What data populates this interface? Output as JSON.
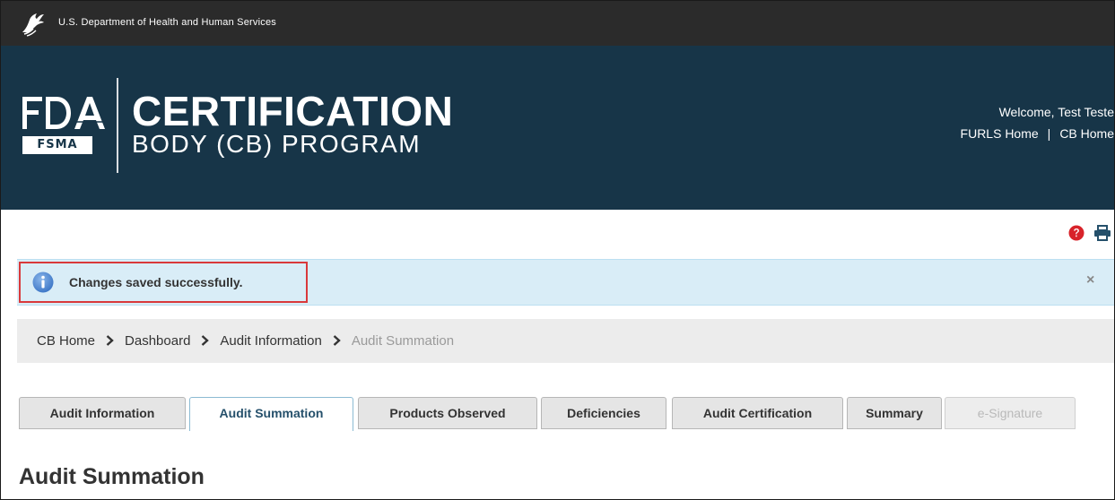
{
  "hhs_bar": {
    "text": "U.S. Department of Health and Human Services",
    "logo_icon": "hhs-eagle-icon"
  },
  "header": {
    "logo_icon": "fda-logo-icon",
    "fsma_badge": "FSMA",
    "title": "CERTIFICATION",
    "subtitle": "BODY (CB) PROGRAM",
    "welcome": "Welcome, Test Teste",
    "links": [
      "FURLS Home",
      "CB Home"
    ],
    "link_separator": "|",
    "background_color": "#173548"
  },
  "tools": {
    "help_icon": "help-icon",
    "print_icon": "print-icon"
  },
  "alert": {
    "icon": "info-icon",
    "message": "Changes saved successfully.",
    "close_label": "×",
    "highlight_color": "#d9393b"
  },
  "breadcrumb": {
    "items": [
      "CB Home",
      "Dashboard",
      "Audit Information",
      "Audit Summation"
    ],
    "separator_icon": "chevron-right-icon"
  },
  "tabs": [
    {
      "label": "Audit Information",
      "state": "default"
    },
    {
      "label": "Audit Summation",
      "state": "active"
    },
    {
      "label": "Products Observed",
      "state": "default"
    },
    {
      "label": "Deficiencies",
      "state": "default"
    },
    {
      "label": "Audit Certification",
      "state": "default"
    },
    {
      "label": "Summary",
      "state": "default"
    },
    {
      "label": "e-Signature",
      "state": "disabled"
    }
  ],
  "page_title": "Audit Summation"
}
